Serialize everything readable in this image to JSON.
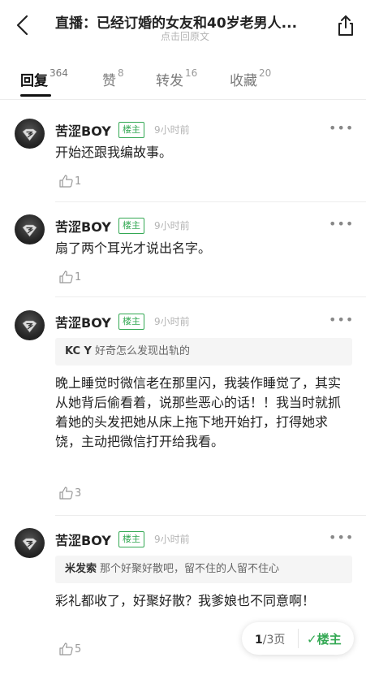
{
  "header": {
    "title": "直播：已经订婚的女友和40岁老男人...",
    "subtitle": "点击回原文"
  },
  "tabs": [
    {
      "label": "回复",
      "count": "364"
    },
    {
      "label": "赞",
      "count": "8"
    },
    {
      "label": "转发",
      "count": "16"
    },
    {
      "label": "收藏",
      "count": "20"
    }
  ],
  "posts": [
    {
      "user": "苦涩BOY",
      "badge": "楼主",
      "time": "9小时前",
      "more": "•••",
      "text": "开始还跟我编故事。",
      "likes": "1"
    },
    {
      "user": "苦涩BOY",
      "badge": "楼主",
      "time": "9小时前",
      "more": "•••",
      "text": "扇了两个耳光才说出名字。",
      "likes": "1"
    },
    {
      "user": "苦涩BOY",
      "badge": "楼主",
      "time": "9小时前",
      "more": "•••",
      "quote_user": "KC Y",
      "quote_text": "好奇怎么发现出轨的",
      "text": "晚上睡觉时微信老在那里闪，我装作睡觉了，其实从她背后偷看着，说那些恶心的话！！我当时就抓着她的头发把她从床上拖下地开始打，打得她求饶，主动把微信打开给我看。",
      "likes": "3"
    },
    {
      "user": "苦涩BOY",
      "badge": "楼主",
      "time": "9小时前",
      "more": "•••",
      "quote_user": "米发索",
      "quote_text": "那个好聚好散吧，留不住的人留不住心",
      "text": "彩礼都收了，好聚好散？我爹娘也不同意啊！",
      "likes": "5"
    }
  ],
  "pager": {
    "current": "1",
    "total": "/3页",
    "only_op": "✓楼主"
  },
  "colors": {
    "accent": "#33a853",
    "muted": "#b4b4b4"
  }
}
